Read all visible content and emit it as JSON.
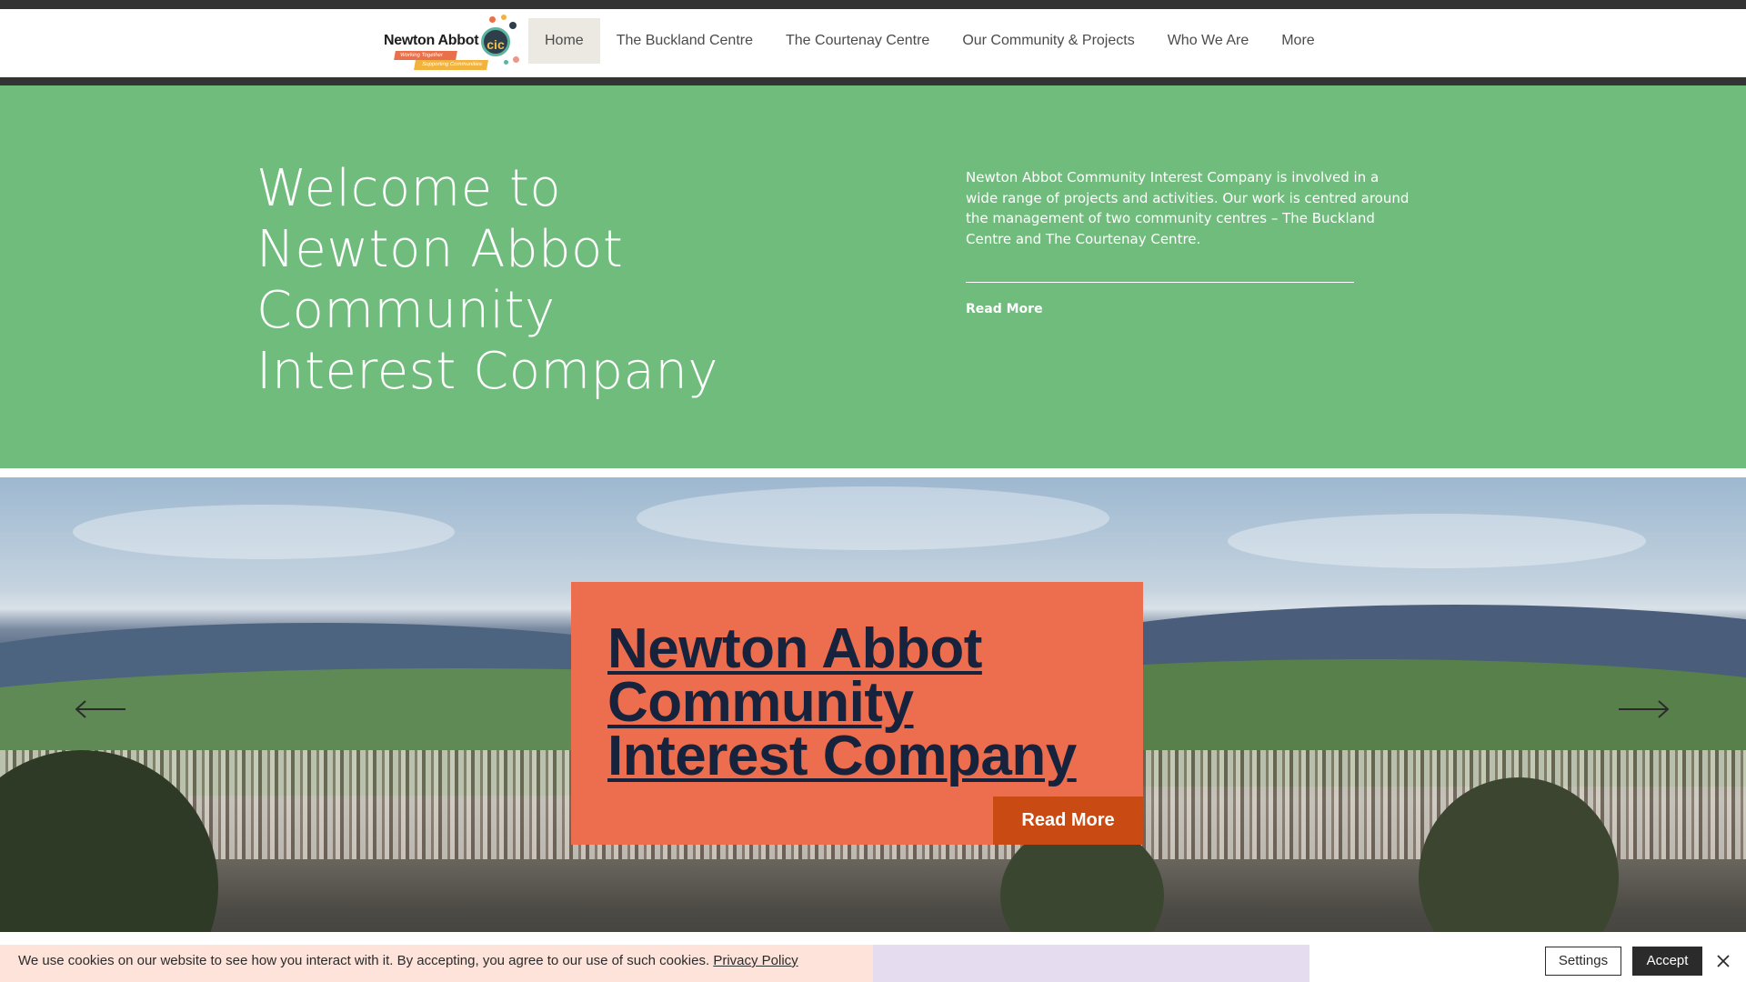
{
  "header": {
    "logo": {
      "wordmark": "Newton Abbot",
      "badge": "cic",
      "tagline_1": "Working Together",
      "tagline_2": "Supporting Communities"
    },
    "nav": [
      {
        "label": "Home",
        "active": true
      },
      {
        "label": "The Buckland Centre",
        "active": false
      },
      {
        "label": "The Courtenay Centre",
        "active": false
      },
      {
        "label": "Our Community & Projects",
        "active": false
      },
      {
        "label": "Who We Are",
        "active": false
      },
      {
        "label": "More",
        "active": false
      }
    ]
  },
  "hero": {
    "title_lines": [
      "Welcome to",
      "Newton Abbot",
      "Community",
      "Interest Company"
    ],
    "intro": "Newton Abbot Community Interest Company is involved in a wide range of projects and activities. Our work is centred around the management of two community centres – The Buckland Centre and The Courtenay Centre.",
    "read_more": "Read More"
  },
  "slideshow": {
    "card_title": "Newton Abbot Community Interest Company",
    "card_button": "Read More",
    "prev_icon": "arrow-left-icon",
    "next_icon": "arrow-right-icon"
  },
  "cookie_banner": {
    "message": "We use cookies on our website to see how you interact with it. By accepting, you agree to our use of such cookies.",
    "policy_link": "Privacy Policy",
    "settings": "Settings",
    "accept": "Accept",
    "close_icon": "close-icon"
  },
  "colors": {
    "green_band": "#6fbc7c",
    "card": "#ec6e4e",
    "card_button": "#c94a13",
    "card_title": "#17233d",
    "nav_active_bg": "#ece9e2",
    "dark_strip": "#333333"
  }
}
